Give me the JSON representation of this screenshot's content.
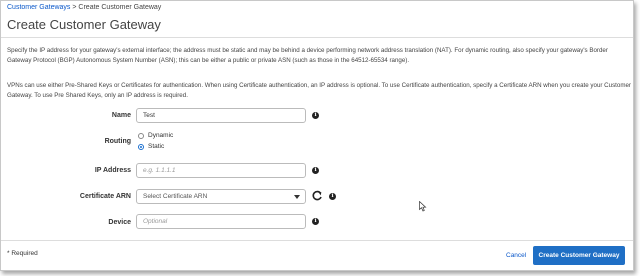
{
  "breadcrumb": {
    "parent": "Customer Gateways",
    "separator": ">",
    "current": "Create Customer Gateway"
  },
  "page": {
    "title": "Create Customer Gateway",
    "description_1": "Specify the IP address for your gateway's external interface; the address must be static and may be behind a device performing network address translation (NAT). For dynamic routing, also specify your gateway's Border Gateway Protocol (BGP) Autonomous System Number (ASN); this can be either a public or private ASN (such as those in the 64512-65534 range).",
    "description_2": "VPNs can use either Pre-Shared Keys or Certificates for authentication. When using Certificate authentication, an IP address is optional. To use Certificate authentication, specify a Certificate ARN when you create your Customer Gateway. To use Pre Shared Keys, only an IP address is required."
  },
  "form": {
    "name": {
      "label": "Name",
      "value": "Test"
    },
    "routing": {
      "label": "Routing",
      "options": [
        "Dynamic",
        "Static"
      ],
      "selected": "Static"
    },
    "ip_address": {
      "label": "IP Address",
      "value": "",
      "placeholder": "e.g. 1.1.1.1"
    },
    "certificate_arn": {
      "label": "Certificate ARN",
      "selected": "Select Certificate ARN"
    },
    "device": {
      "label": "Device",
      "value": "",
      "placeholder": "Optional"
    }
  },
  "footer": {
    "required_note": "* Required",
    "cancel_label": "Cancel",
    "submit_label": "Create Customer Gateway"
  },
  "icons": {
    "info": "info-icon",
    "refresh": "refresh-icon",
    "dropdown": "caret-down-icon",
    "cursor": "mouse-cursor-icon"
  },
  "colors": {
    "link": "#0a58ca",
    "primary_button": "#1f6fc5",
    "radio_selected": "#1a6fd0"
  }
}
